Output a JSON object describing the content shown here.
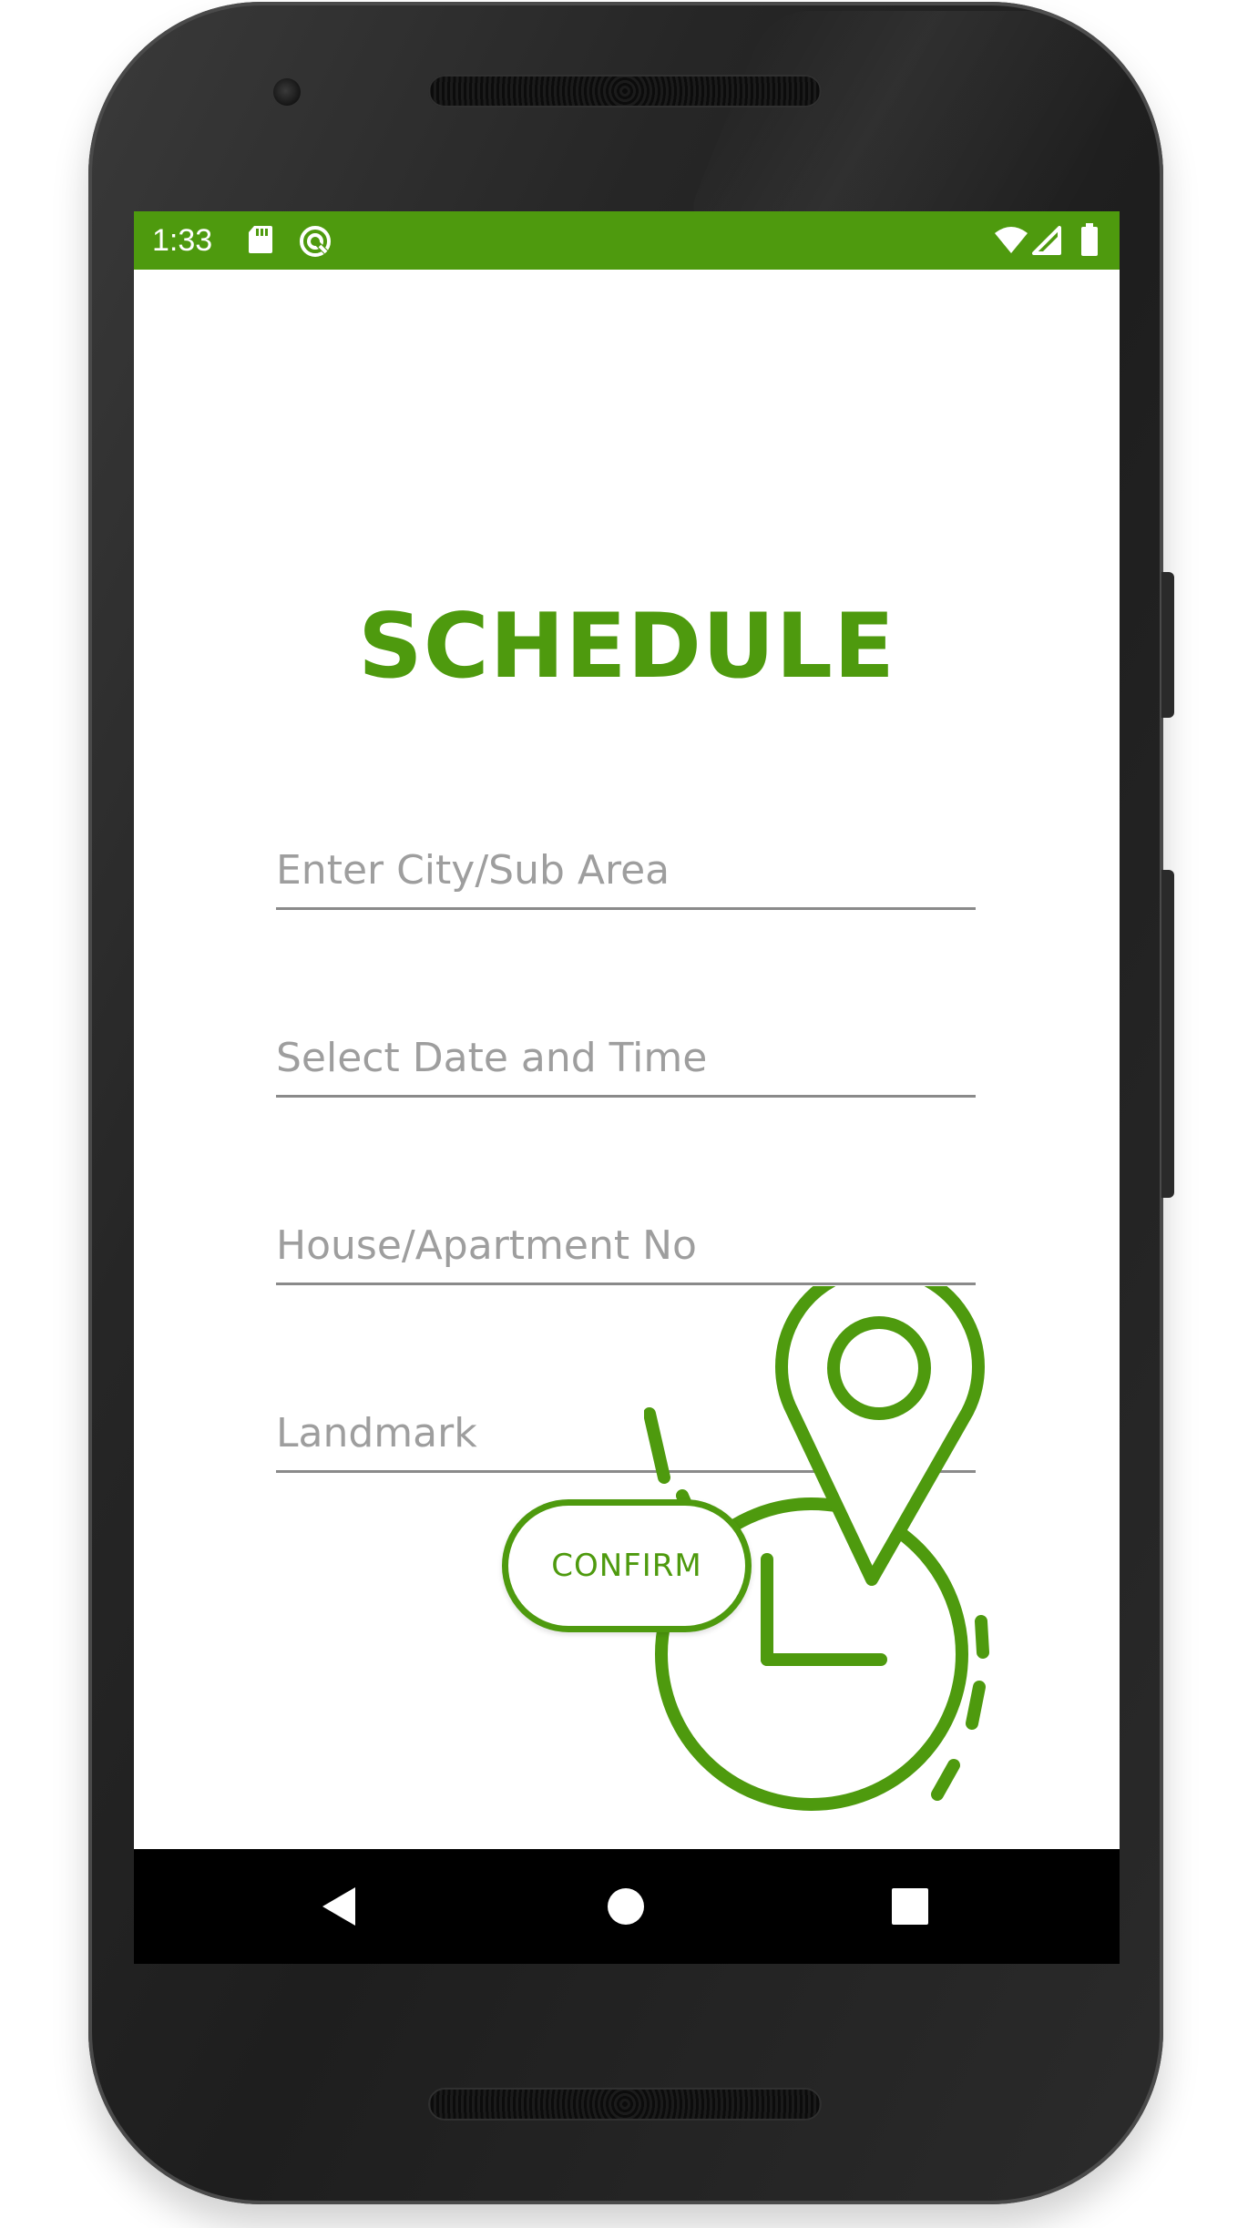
{
  "status_bar": {
    "time": "1:33",
    "background": "#4e9a0e",
    "icons": [
      "sd-card-icon",
      "sync-icon",
      "wifi-icon",
      "signal-icon",
      "battery-icon"
    ]
  },
  "screen": {
    "title": "SCHEDULE",
    "accent_color": "#4e9a0e",
    "fields": [
      {
        "placeholder": "Enter City/Sub Area",
        "value": ""
      },
      {
        "placeholder": "Select Date and Time",
        "value": ""
      },
      {
        "placeholder": "House/Apartment No",
        "value": ""
      },
      {
        "placeholder": "Landmark",
        "value": ""
      }
    ],
    "confirm_label": "CONFIRM",
    "illustration_icons": [
      "clock-icon",
      "location-pin-icon"
    ]
  },
  "nav_bar": {
    "buttons": [
      "back-icon",
      "home-icon",
      "recents-icon"
    ]
  }
}
